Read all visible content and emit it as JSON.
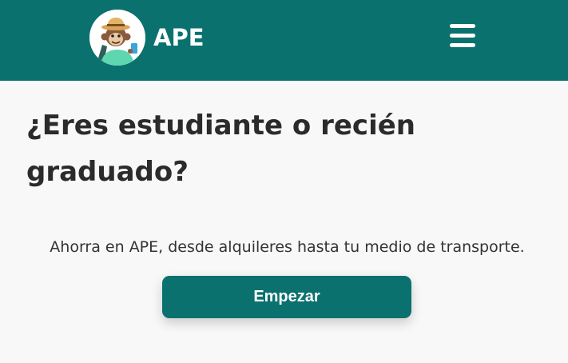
{
  "header": {
    "brand_name": "APE",
    "logo_icon": "monkey-explorer-logo",
    "menu_icon": "hamburger-menu-icon",
    "background_color": "#0a716e"
  },
  "hero": {
    "title_line1": "¿Eres estudiante o recién",
    "title_line2": "graduado?",
    "subtitle": "Ahorra en APE, desde alquileres hasta tu medio de transporte.",
    "cta_label": "Empezar"
  },
  "colors": {
    "primary": "#0a716e",
    "page_background": "#f8f8f8",
    "text_dark": "#2b2b2b"
  }
}
